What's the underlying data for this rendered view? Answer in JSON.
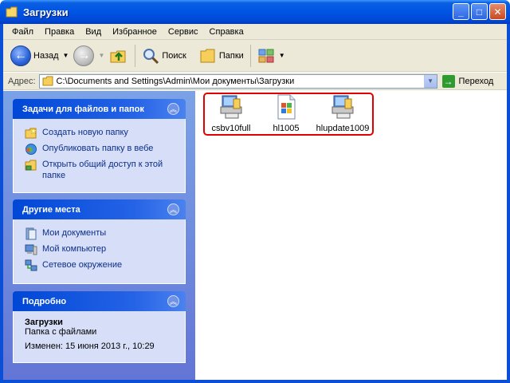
{
  "window": {
    "title": "Загрузки",
    "buttons": {
      "minimize": "_",
      "maximize": "□",
      "close": "✕"
    }
  },
  "menubar": [
    "Файл",
    "Правка",
    "Вид",
    "Избранное",
    "Сервис",
    "Справка"
  ],
  "toolbar": {
    "back_label": "Назад",
    "search_label": "Поиск",
    "folders_label": "Папки"
  },
  "address": {
    "label": "Адрес:",
    "value": "C:\\Documents and Settings\\Admin\\Мои документы\\Загрузки",
    "go_label": "Переход"
  },
  "tasks_panel": {
    "title": "Задачи для файлов и папок",
    "items": [
      {
        "label": "Создать новую папку",
        "icon": "new-folder-icon"
      },
      {
        "label": "Опубликовать папку в вебе",
        "icon": "globe-icon"
      },
      {
        "label": "Открыть общий доступ к этой папке",
        "icon": "share-folder-icon"
      }
    ]
  },
  "places_panel": {
    "title": "Другие места",
    "items": [
      {
        "label": "Мои документы",
        "icon": "documents-icon"
      },
      {
        "label": "Мой компьютер",
        "icon": "computer-icon"
      },
      {
        "label": "Сетевое окружение",
        "icon": "network-icon"
      }
    ]
  },
  "details_panel": {
    "title": "Подробно",
    "name": "Загрузки",
    "type": "Папка с файлами",
    "modified": "Изменен: 15 июня 2013 г., 10:29"
  },
  "files": [
    {
      "name": "csbv10full",
      "icon": "installer-icon"
    },
    {
      "name": "hl1005",
      "icon": "windows-file-icon"
    },
    {
      "name": "hlupdate1009",
      "icon": "installer-icon"
    }
  ],
  "colors": {
    "titlebar": "#0055e5",
    "taskpane": "#7ba2e7",
    "selection_highlight": "#e00000"
  }
}
